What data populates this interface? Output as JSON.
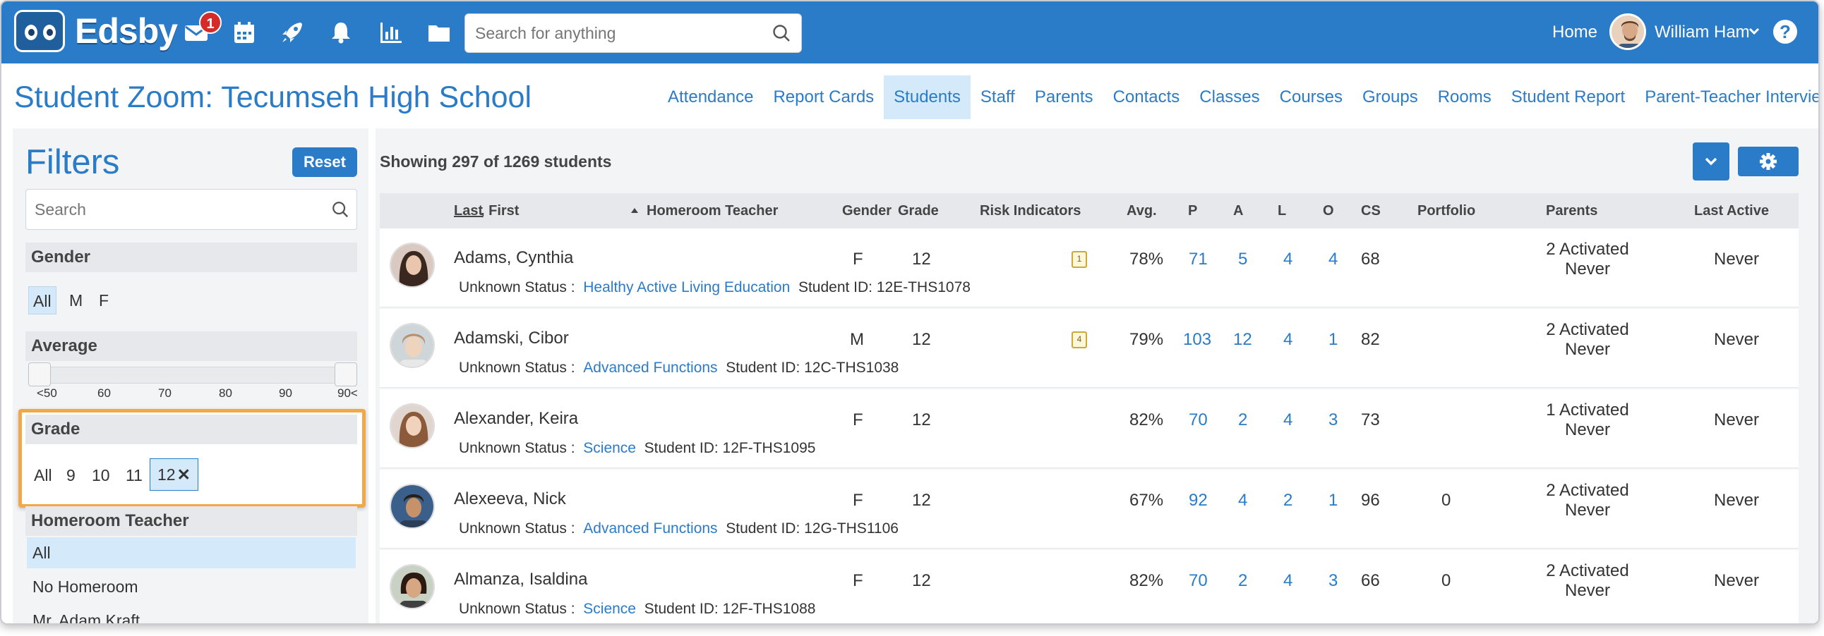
{
  "app": {
    "logo_text": "Edsby",
    "notification_count": "1",
    "search_placeholder": "Search for anything",
    "home_label": "Home",
    "user_name": "William Ham",
    "help_label": "?"
  },
  "page": {
    "title": "Student Zoom: Tecumseh High School"
  },
  "nav": [
    {
      "label": "Attendance"
    },
    {
      "label": "Report Cards"
    },
    {
      "label": "Students"
    },
    {
      "label": "Staff"
    },
    {
      "label": "Parents"
    },
    {
      "label": "Contacts"
    },
    {
      "label": "Classes"
    },
    {
      "label": "Courses"
    },
    {
      "label": "Groups"
    },
    {
      "label": "Rooms"
    },
    {
      "label": "Student Report"
    },
    {
      "label": "Parent-Teacher Interviews"
    }
  ],
  "filters": {
    "title": "Filters",
    "reset_label": "Reset",
    "search_placeholder": "Search",
    "gender": {
      "label": "Gender",
      "options": [
        "All",
        "M",
        "F"
      ],
      "selected": "All"
    },
    "average": {
      "label": "Average",
      "ticks": [
        "<50",
        "60",
        "70",
        "80",
        "90",
        "90<"
      ]
    },
    "grade": {
      "label": "Grade",
      "options": [
        "All",
        "9",
        "10",
        "11"
      ],
      "selected_chip": "12",
      "remove_symbol": "✕"
    },
    "homeroom": {
      "label": "Homeroom Teacher",
      "options": [
        "All",
        "No Homeroom",
        "Mr. Adam Kraft"
      ],
      "selected": "All"
    }
  },
  "results": {
    "showing_text": "Showing 297 of 1269 students"
  },
  "table": {
    "headers": {
      "last": "Last",
      "first": ", First",
      "homeroom": "Homeroom Teacher",
      "gender": "Gender",
      "grade": "Grade",
      "risk": "Risk Indicators",
      "avg": "Avg.",
      "p": "P",
      "a": "A",
      "l": "L",
      "o": "O",
      "cs": "CS",
      "portfolio": "Portfolio",
      "parents": "Parents",
      "last_active": "Last Active"
    },
    "rows": [
      {
        "name": "Adams, Cynthia",
        "status": "Unknown Status",
        "course": "Healthy Active Living Education",
        "student_id": "Student ID: 12E-THS1078",
        "gender": "F",
        "grade": "12",
        "risk_count": "1",
        "avg": "78%",
        "p": "71",
        "a": "5",
        "l": "4",
        "o": "4",
        "cs": "68",
        "portfolio": "",
        "parents_line1": "2 Activated",
        "parents_line2": "Never",
        "last_active": "Never"
      },
      {
        "name": "Adamski, Cibor",
        "status": "Unknown Status",
        "course": "Advanced Functions",
        "student_id": "Student ID: 12C-THS1038",
        "gender": "M",
        "grade": "12",
        "risk_count": "4",
        "avg": "79%",
        "p": "103",
        "a": "12",
        "l": "4",
        "o": "1",
        "cs": "82",
        "portfolio": "",
        "parents_line1": "2 Activated",
        "parents_line2": "Never",
        "last_active": "Never"
      },
      {
        "name": "Alexander, Keira",
        "status": "Unknown Status",
        "course": "Science",
        "student_id": "Student ID: 12F-THS1095",
        "gender": "F",
        "grade": "12",
        "risk_count": "",
        "avg": "82%",
        "p": "70",
        "a": "2",
        "l": "4",
        "o": "3",
        "cs": "73",
        "portfolio": "",
        "parents_line1": "1 Activated",
        "parents_line2": "Never",
        "last_active": "Never"
      },
      {
        "name": "Alexeeva, Nick",
        "status": "Unknown Status",
        "course": "Advanced Functions",
        "student_id": "Student ID: 12G-THS1106",
        "gender": "F",
        "grade": "12",
        "risk_count": "",
        "avg": "67%",
        "p": "92",
        "a": "4",
        "l": "2",
        "o": "1",
        "cs": "96",
        "portfolio": "0",
        "parents_line1": "2 Activated",
        "parents_line2": "Never",
        "last_active": "Never"
      },
      {
        "name": "Almanza, Isaldina",
        "status": "Unknown Status",
        "course": "Science",
        "student_id": "Student ID: 12F-THS1088",
        "gender": "F",
        "grade": "12",
        "risk_count": "",
        "avg": "82%",
        "p": "70",
        "a": "2",
        "l": "4",
        "o": "3",
        "cs": "66",
        "portfolio": "0",
        "parents_line1": "2 Activated",
        "parents_line2": "Never",
        "last_active": "Never"
      }
    ]
  },
  "colors": {
    "brand_blue": "#2a7bc8",
    "highlight_orange": "#f0a84a",
    "selected_bg": "#d4e9f9"
  }
}
